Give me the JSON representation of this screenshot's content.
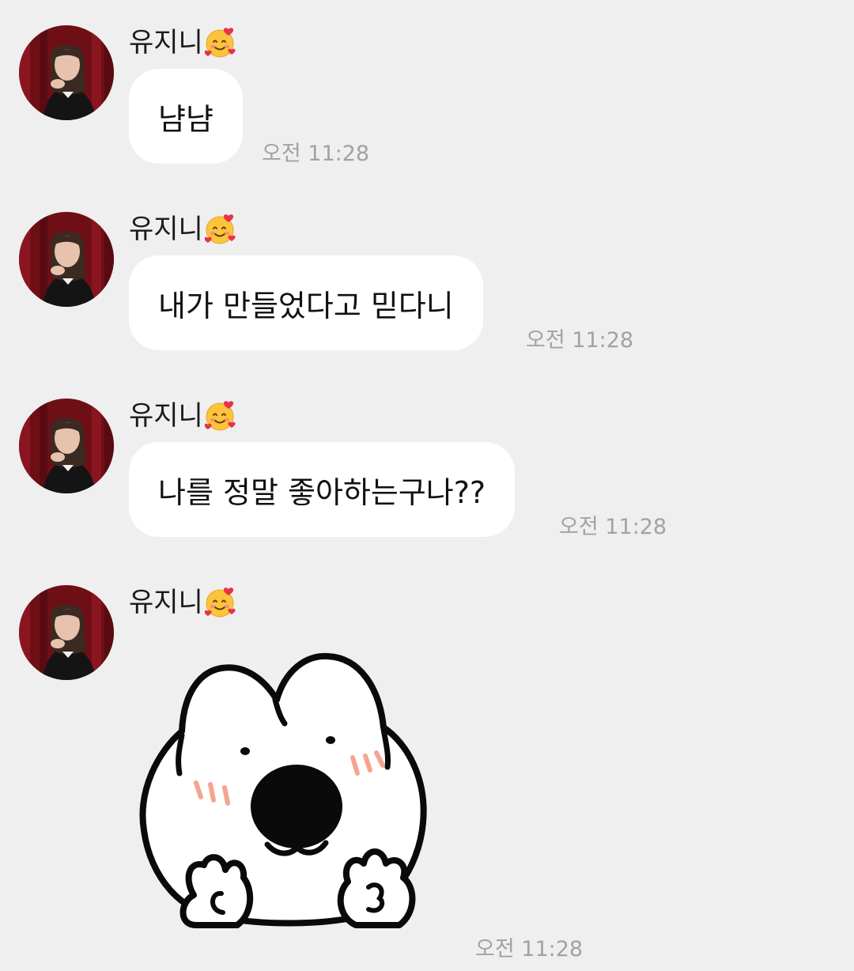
{
  "sender_name": "유지니",
  "sender_emoji": "smiling-face-with-hearts-icon",
  "messages": [
    {
      "type": "text",
      "text": "냠냠",
      "time": "오전 11:28"
    },
    {
      "type": "text",
      "text": "내가 만들었다고 믿다니",
      "time": "오전 11:28"
    },
    {
      "type": "text",
      "text": "나를 정말 좋아하는구나??",
      "time": "오전 11:28"
    },
    {
      "type": "sticker",
      "sticker": "white-bunny-peace-sign-sticker",
      "time": "오전 11:28"
    }
  ],
  "colors": {
    "background": "#efefef",
    "bubble": "#ffffff",
    "time_text": "#a2a2a2"
  }
}
